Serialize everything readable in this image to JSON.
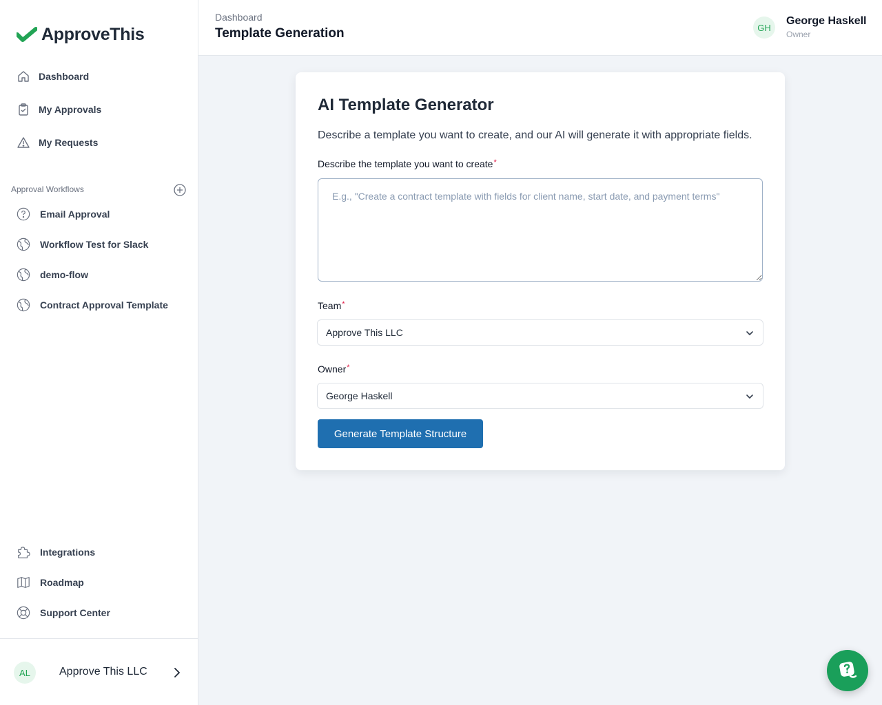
{
  "brand": {
    "name": "ApproveThis",
    "accent": "#22a455"
  },
  "sidebar": {
    "nav": [
      {
        "label": "Dashboard",
        "icon": "home-icon"
      },
      {
        "label": "My Approvals",
        "icon": "clipboard-check-icon"
      },
      {
        "label": "My Requests",
        "icon": "warning-triangle-icon"
      }
    ],
    "workflows_title": "Approval Workflows",
    "workflows": [
      {
        "label": "Email Approval",
        "icon": "question-circle-icon"
      },
      {
        "label": "Workflow Test for Slack",
        "icon": "globe-icon"
      },
      {
        "label": "demo-flow",
        "icon": "globe-icon"
      },
      {
        "label": "Contract Approval Template",
        "icon": "globe-icon"
      }
    ],
    "bottom": [
      {
        "label": "Integrations",
        "icon": "puzzle-icon"
      },
      {
        "label": "Roadmap",
        "icon": "map-icon"
      },
      {
        "label": "Support Center",
        "icon": "lifebuoy-icon"
      }
    ],
    "org": {
      "initials": "AL",
      "name": "Approve This LLC"
    }
  },
  "header": {
    "breadcrumb": "Dashboard",
    "title": "Template Generation",
    "user": {
      "initials": "GH",
      "name": "George Haskell",
      "role": "Owner"
    }
  },
  "card": {
    "title": "AI Template Generator",
    "description": "Describe a template you want to create, and our AI will generate it with appropriate fields.",
    "prompt_label": "Describe the template you want to create",
    "prompt_placeholder": "E.g., \"Create a contract template with fields for client name, start date, and payment terms\"",
    "prompt_value": "",
    "team_label": "Team",
    "team_value": "Approve This LLC",
    "owner_label": "Owner",
    "owner_value": "George Haskell",
    "required_mark": "*",
    "submit_label": "Generate Template Structure"
  },
  "colors": {
    "primary_button": "#1f6fb0",
    "chat_fab": "#1a9f5a",
    "required": "#e11d48"
  }
}
